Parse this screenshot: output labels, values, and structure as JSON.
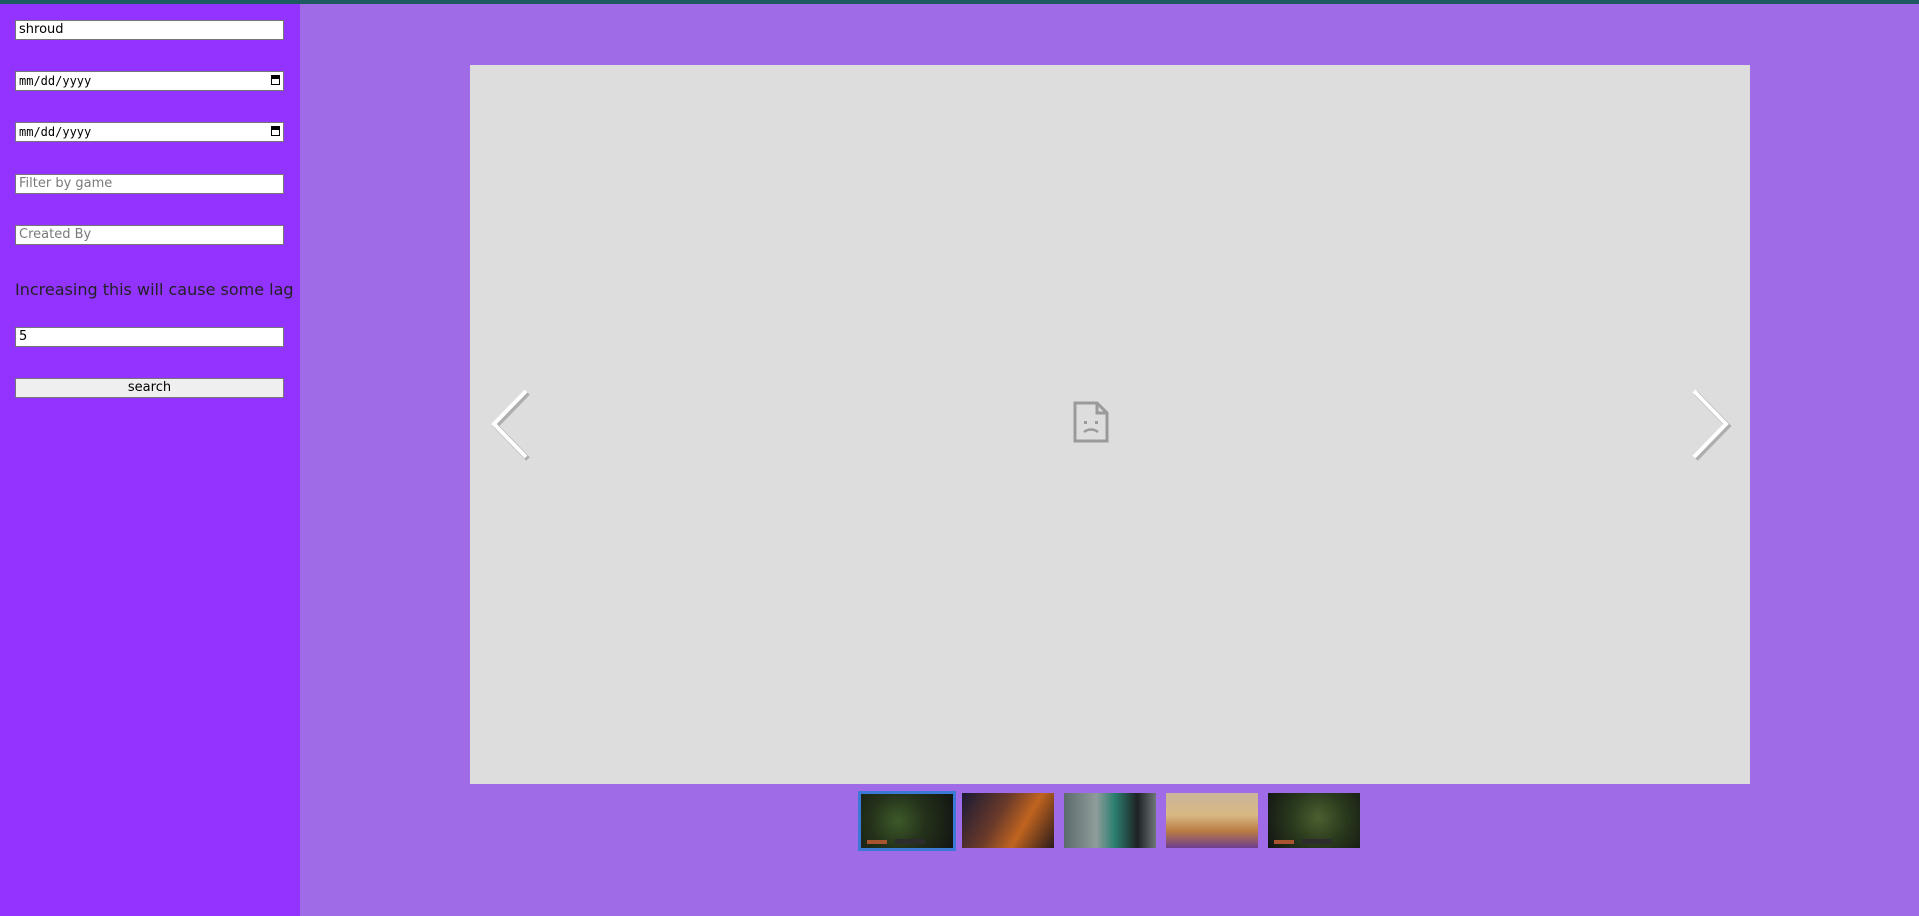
{
  "filters": {
    "channel_value": "shroud",
    "start_date_placeholder": "mm/dd/yyyy",
    "end_date_placeholder": "mm/dd/yyyy",
    "game_placeholder": "Filter by game",
    "creator_placeholder": "Created By",
    "lag_warning": "Increasing this will cause some lag",
    "count_value": "5",
    "search_label": "search"
  },
  "viewer": {
    "state": "broken-image",
    "thumbnail_count": 5,
    "active_thumbnail": 1
  },
  "colors": {
    "sidebar": "#9333ff",
    "page": "#9f6be6",
    "viewer_bg": "#dddddd",
    "active_thumb_border": "#3a7ad6"
  },
  "icons": [
    "calendar-icon",
    "broken-image-icon",
    "arrow-left-icon",
    "arrow-right-icon"
  ]
}
